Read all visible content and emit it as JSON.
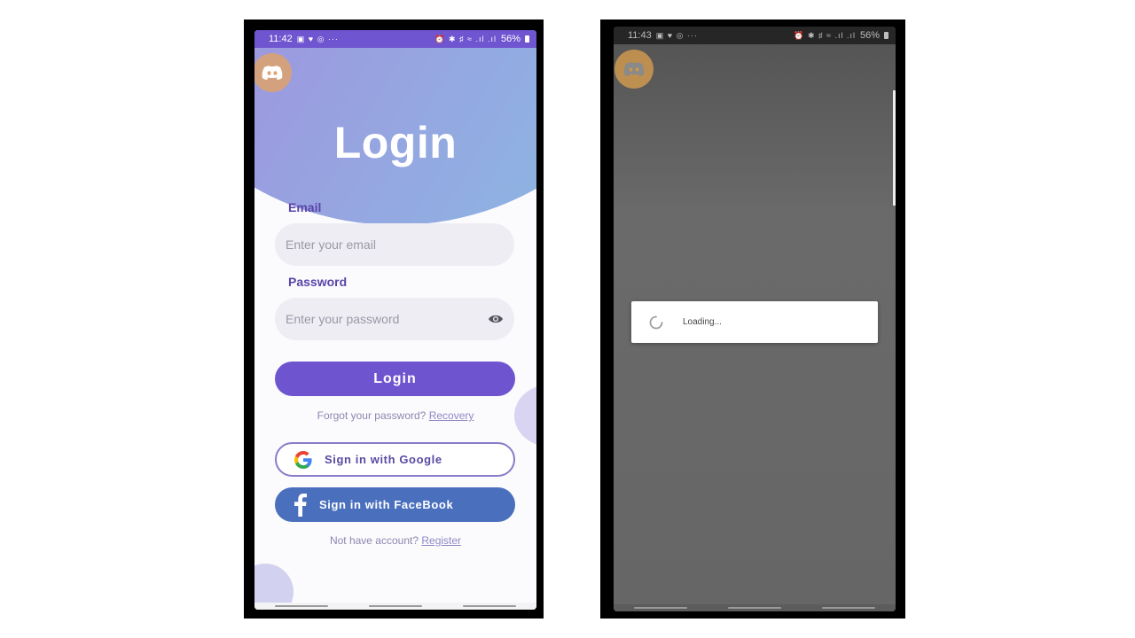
{
  "left_screen": {
    "status": {
      "time": "11:42",
      "icons": "▣ ♥ ◎ ···",
      "right_icons": "⏰ ✱ ♯ ≈ .ıl .ıl",
      "battery": "56%"
    },
    "title": "Login",
    "email": {
      "label": "Email",
      "placeholder": "Enter your email"
    },
    "password": {
      "label": "Password",
      "placeholder": "Enter your password"
    },
    "login_button": "Login",
    "forgot": {
      "text": "Forgot your password?",
      "link": "Recovery"
    },
    "google_button": "Sign in with Google",
    "facebook_button": "Sign in with FaceBook",
    "register": {
      "text": "Not have account?",
      "link": "Register"
    },
    "colors": {
      "accent": "#6e55cf",
      "facebook": "#4a6fbd",
      "label": "#5a45a8"
    },
    "icons": [
      "discord-icon",
      "eye-icon",
      "google-icon",
      "facebook-icon"
    ]
  },
  "right_screen": {
    "status": {
      "time": "11:43",
      "icons": "▣ ♥ ◎ ···",
      "right_icons": "⏰ ✱ ♯ ≈ .ıl .ıl",
      "battery": "56%"
    },
    "loading_text": "Loading...",
    "icons": [
      "discord-icon",
      "spinner-icon"
    ]
  }
}
